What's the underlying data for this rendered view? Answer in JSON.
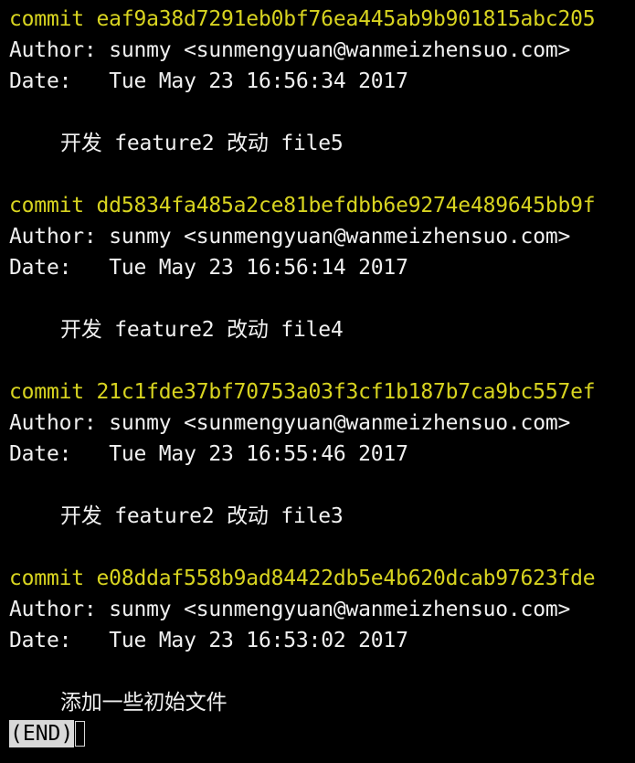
{
  "labels": {
    "author_prefix": "Author: ",
    "date_prefix": "Date:   ",
    "commit_prefix": "commit "
  },
  "commits": [
    {
      "hash": "eaf9a38d7291eb0bf76ea445ab9b901815abc205",
      "author": "sunmy <sunmengyuan@wanmeizhensuo.com>",
      "date": "Tue May 23 16:56:34 2017",
      "message": "开发 feature2 改动 file5"
    },
    {
      "hash": "dd5834fa485a2ce81befdbb6e9274e489645bb9f",
      "author": "sunmy <sunmengyuan@wanmeizhensuo.com>",
      "date": "Tue May 23 16:56:14 2017",
      "message": "开发 feature2 改动 file4"
    },
    {
      "hash": "21c1fde37bf70753a03f3cf1b187b7ca9bc557ef",
      "author": "sunmy <sunmengyuan@wanmeizhensuo.com>",
      "date": "Tue May 23 16:55:46 2017",
      "message": "开发 feature2 改动 file3"
    },
    {
      "hash": "e08ddaf558b9ad84422db5e4b620dcab97623fde",
      "author": "sunmy <sunmengyuan@wanmeizhensuo.com>",
      "date": "Tue May 23 16:53:02 2017",
      "message": "添加一些初始文件"
    }
  ],
  "pager": {
    "status": "(END)"
  },
  "colors": {
    "background": "#000000",
    "text": "#f0f0f0",
    "commit_hash": "#d8d420",
    "pager_highlight": "#d8d8d8"
  }
}
